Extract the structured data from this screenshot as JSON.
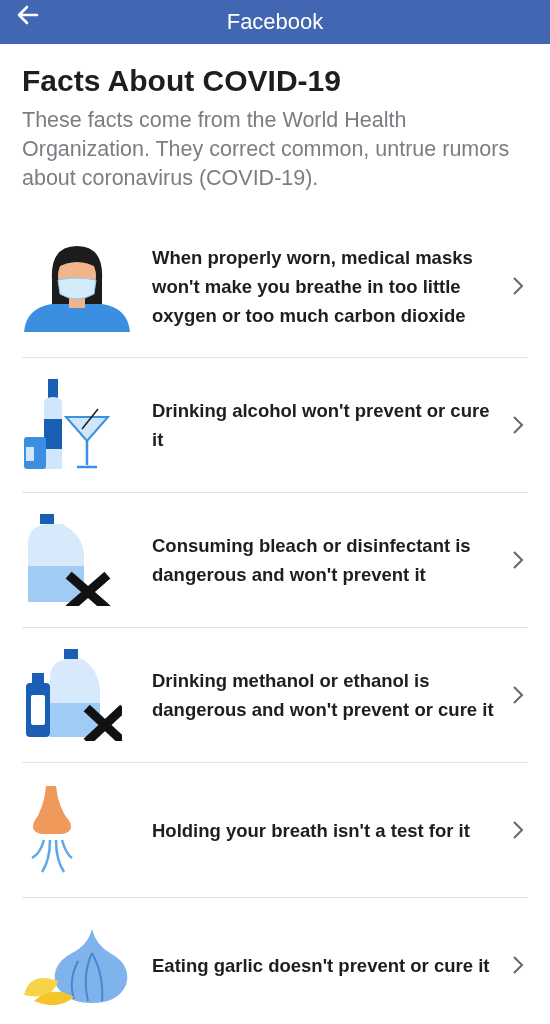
{
  "app_bar": {
    "title": "Facebook"
  },
  "heading": "Facts About COVID-19",
  "intro": "These facts come from the World Health Organization. They correct common, untrue rumors about coronavirus (COVID-19).",
  "facts": [
    {
      "text": "When properly worn, medical masks won't make you breathe in too little oxygen or too much carbon dioxide"
    },
    {
      "text": "Drinking alcohol won't prevent or cure it"
    },
    {
      "text": "Consuming bleach or disinfectant is dangerous and won't prevent it"
    },
    {
      "text": "Drinking methanol or ethanol is dangerous and won't prevent or cure it"
    },
    {
      "text": "Holding your breath isn't a test for it"
    },
    {
      "text": "Eating garlic doesn't prevent or cure it"
    }
  ]
}
